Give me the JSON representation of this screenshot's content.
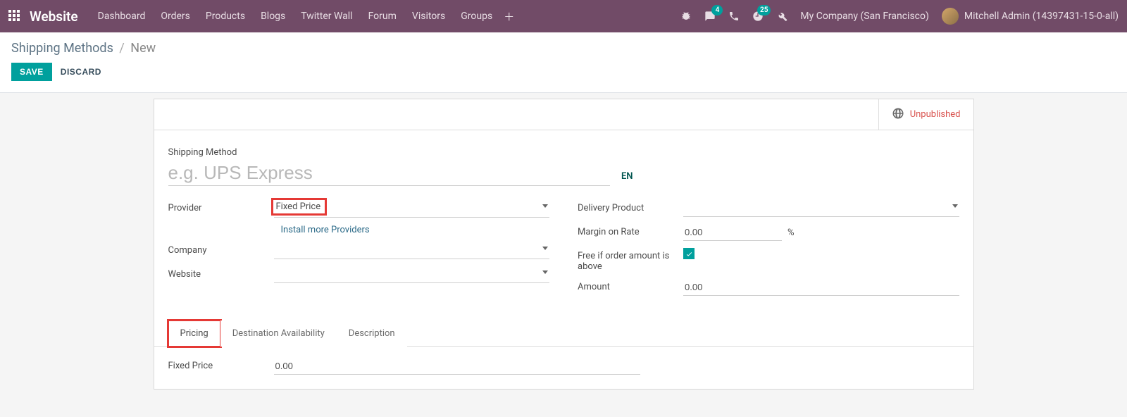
{
  "navbar": {
    "brand": "Website",
    "links": [
      "Dashboard",
      "Orders",
      "Products",
      "Blogs",
      "Twitter Wall",
      "Forum",
      "Visitors",
      "Groups"
    ],
    "messages_badge": "4",
    "activities_badge": "25",
    "company": "My Company (San Francisco)",
    "user": "Mitchell Admin (14397431-15-0-all)"
  },
  "breadcrumb": {
    "root": "Shipping Methods",
    "current": "New"
  },
  "buttons": {
    "save": "SAVE",
    "discard": "DISCARD"
  },
  "status": {
    "unpublished": "Unpublished"
  },
  "form": {
    "title_label": "Shipping Method",
    "title_placeholder": "e.g. UPS Express",
    "title_value": "",
    "lang": "EN",
    "left": {
      "provider_label": "Provider",
      "provider_value": "Fixed Price",
      "install_more": "Install more Providers",
      "company_label": "Company",
      "company_value": "",
      "website_label": "Website",
      "website_value": ""
    },
    "right": {
      "delivery_product_label": "Delivery Product",
      "delivery_product_value": "",
      "margin_label": "Margin on Rate",
      "margin_value": "0.00",
      "margin_suffix": "%",
      "free_if_label": "Free if order amount is above",
      "free_if_checked": true,
      "amount_label": "Amount",
      "amount_value": "0.00"
    }
  },
  "tabs": {
    "items": [
      "Pricing",
      "Destination Availability",
      "Description"
    ],
    "active": 0
  },
  "tab_pricing": {
    "fixed_price_label": "Fixed Price",
    "fixed_price_value": "0.00"
  }
}
